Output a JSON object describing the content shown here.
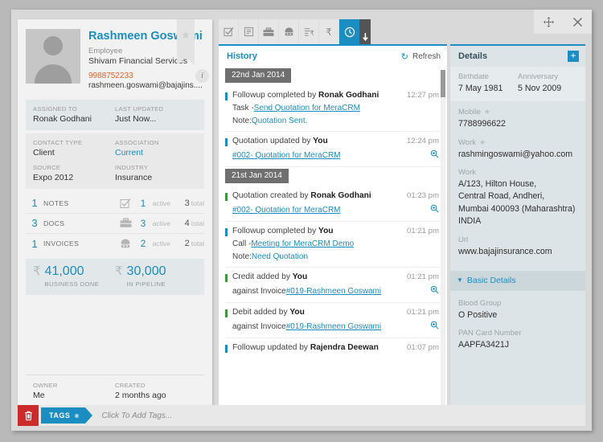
{
  "window": {
    "move_icon": "move-icon",
    "close_icon": "close-icon"
  },
  "contact": {
    "name": "Rashmeen Goswami",
    "role": "Employee",
    "company": "Shivam Financial Services",
    "phone": "9988752233",
    "email": "rashmeen.goswami@bajajins....",
    "star_icon": "star-icon",
    "info_icon": "info-icon",
    "assigned_to_label": "ASSIGNED TO",
    "assigned_to_value": "Ronak Godhani",
    "last_updated_label": "LAST UPDATED",
    "last_updated_value": "Just Now...",
    "contact_type_label": "CONTACT TYPE",
    "contact_type_value": "Client",
    "association_label": "ASSOCIATION",
    "association_value": "Current",
    "source_label": "SOURCE",
    "source_value": "Expo 2012",
    "industry_label": "INDUSTRY",
    "industry_value": "Insurance",
    "owner_label": "OWNER",
    "owner_value": "Me",
    "created_label": "CREATED",
    "created_value": "2 months ago"
  },
  "stats": [
    {
      "count": "1",
      "name": "NOTES",
      "icon": "task-check-icon",
      "active": "1",
      "active_label": "active",
      "total": "3",
      "total_label": "total"
    },
    {
      "count": "3",
      "name": "DOCS",
      "icon": "briefcase-icon",
      "active": "3",
      "active_label": "active",
      "total": "4",
      "total_label": "total"
    },
    {
      "count": "1",
      "name": "INVOICES",
      "icon": "persona-icon",
      "active": "2",
      "active_label": "active",
      "total": "2",
      "total_label": "total"
    }
  ],
  "money": {
    "currency": "₹",
    "business_done_value": "41,000",
    "business_done_label": "BUSINESS DONE",
    "pipeline_value": "30,000",
    "pipeline_label": "IN PIPELINE"
  },
  "tags": {
    "trash_icon": "trash-icon",
    "label": "TAGS",
    "placeholder": "Click To Add Tags..."
  },
  "toolbar": {
    "items": [
      {
        "icon": "task-check-icon",
        "active": false
      },
      {
        "icon": "note-icon",
        "active": false
      },
      {
        "icon": "briefcase-icon",
        "active": false
      },
      {
        "icon": "persona-icon",
        "active": false
      },
      {
        "icon": "invoice-list-icon",
        "active": false
      },
      {
        "icon": "rupee-icon",
        "active": false
      },
      {
        "icon": "history-clock-icon",
        "active": true
      }
    ],
    "caret_icon": "caret-down-icon"
  },
  "history": {
    "title": "History",
    "refresh_label": "Refresh",
    "refresh_icon": "refresh-icon",
    "groups": [
      {
        "date": "22nd Jan 2014",
        "events": [
          {
            "bar": "#1b8dc0",
            "text_prefix": "Followup completed by ",
            "actor": "Ronak Godhani",
            "time": "12:27 pm",
            "sub1_prefix": "Task - ",
            "sub1_link": "Send Quotation for MeraCRM",
            "sub2_prefix": "Note: ",
            "sub2_note": "Quotation Sent.",
            "magnifier": false
          },
          {
            "bar": "#1b8dc0",
            "text_prefix": "Quotation updated by ",
            "actor": "You",
            "time": "12:24 pm",
            "sub1_prefix": "",
            "sub1_link": "#002- Quotation for MeraCRM",
            "magnifier": true,
            "magnifier_icon": "magnifier-icon"
          }
        ]
      },
      {
        "date": "21st Jan 2014",
        "events": [
          {
            "bar": "#3c9a3c",
            "text_prefix": "Quotation created by ",
            "actor": "Ronak Godhani",
            "time": "01:23 pm",
            "sub1_prefix": "",
            "sub1_link": "#002- Quotation for MeraCRM",
            "magnifier": true,
            "magnifier_icon": "magnifier-icon"
          },
          {
            "bar": "#1b8dc0",
            "text_prefix": "Followup completed by ",
            "actor": "You",
            "time": "01:21 pm",
            "sub1_prefix": "Call - ",
            "sub1_link": "Meeting for MeraCRM Demo",
            "sub2_prefix": "Note: ",
            "sub2_note": "Need Quotation",
            "magnifier": false
          },
          {
            "bar": "#3c9a3c",
            "text_prefix": "Credit added by ",
            "actor": "You",
            "time": "01:21 pm",
            "sub1_prefix": "against Invoice ",
            "sub1_link": "#019-Rashmeen Goswami",
            "magnifier": true,
            "magnifier_icon": "magnifier-icon"
          },
          {
            "bar": "#3c9a3c",
            "text_prefix": "Debit added by ",
            "actor": "You",
            "time": "01:21 pm",
            "sub1_prefix": "against Invoice ",
            "sub1_link": "#019-Rashmeen Goswami",
            "magnifier": true,
            "magnifier_icon": "magnifier-icon"
          },
          {
            "bar": "#1b8dc0",
            "text_prefix": "Followup updated by ",
            "actor": "Rajendra Deewan",
            "time": "01:07 pm",
            "magnifier": false
          }
        ]
      }
    ]
  },
  "details": {
    "title": "Details",
    "add_icon": "plus-icon",
    "birthdate_label": "Birthdate",
    "birthdate_value": "7 May 1981",
    "anniversary_label": "Anniversary",
    "anniversary_value": "5 Nov 2009",
    "mobile_label": "Mobile",
    "mobile_star": "star-icon",
    "mobile_value": "7788996622",
    "work_email_label": "Work",
    "work_email_star": "star-icon",
    "work_email_value": "rashmingoswami@yahoo.com",
    "work_addr_label": "Work",
    "work_addr_line1": "A/123, Hilton House,",
    "work_addr_line2": "Central Road, Andheri,",
    "work_addr_line3": "Mumbai 400093 (Maharashtra) INDIA",
    "url_label": "Url",
    "url_value": "www.bajajinsurance.com",
    "basic_details_label": "Basic Details",
    "basic_caret": "caret-down-icon",
    "blood_group_label": "Blood Group",
    "blood_group_value": "O Positive",
    "pan_label": "PAN Card Number",
    "pan_value": "AAPFA3421J"
  }
}
